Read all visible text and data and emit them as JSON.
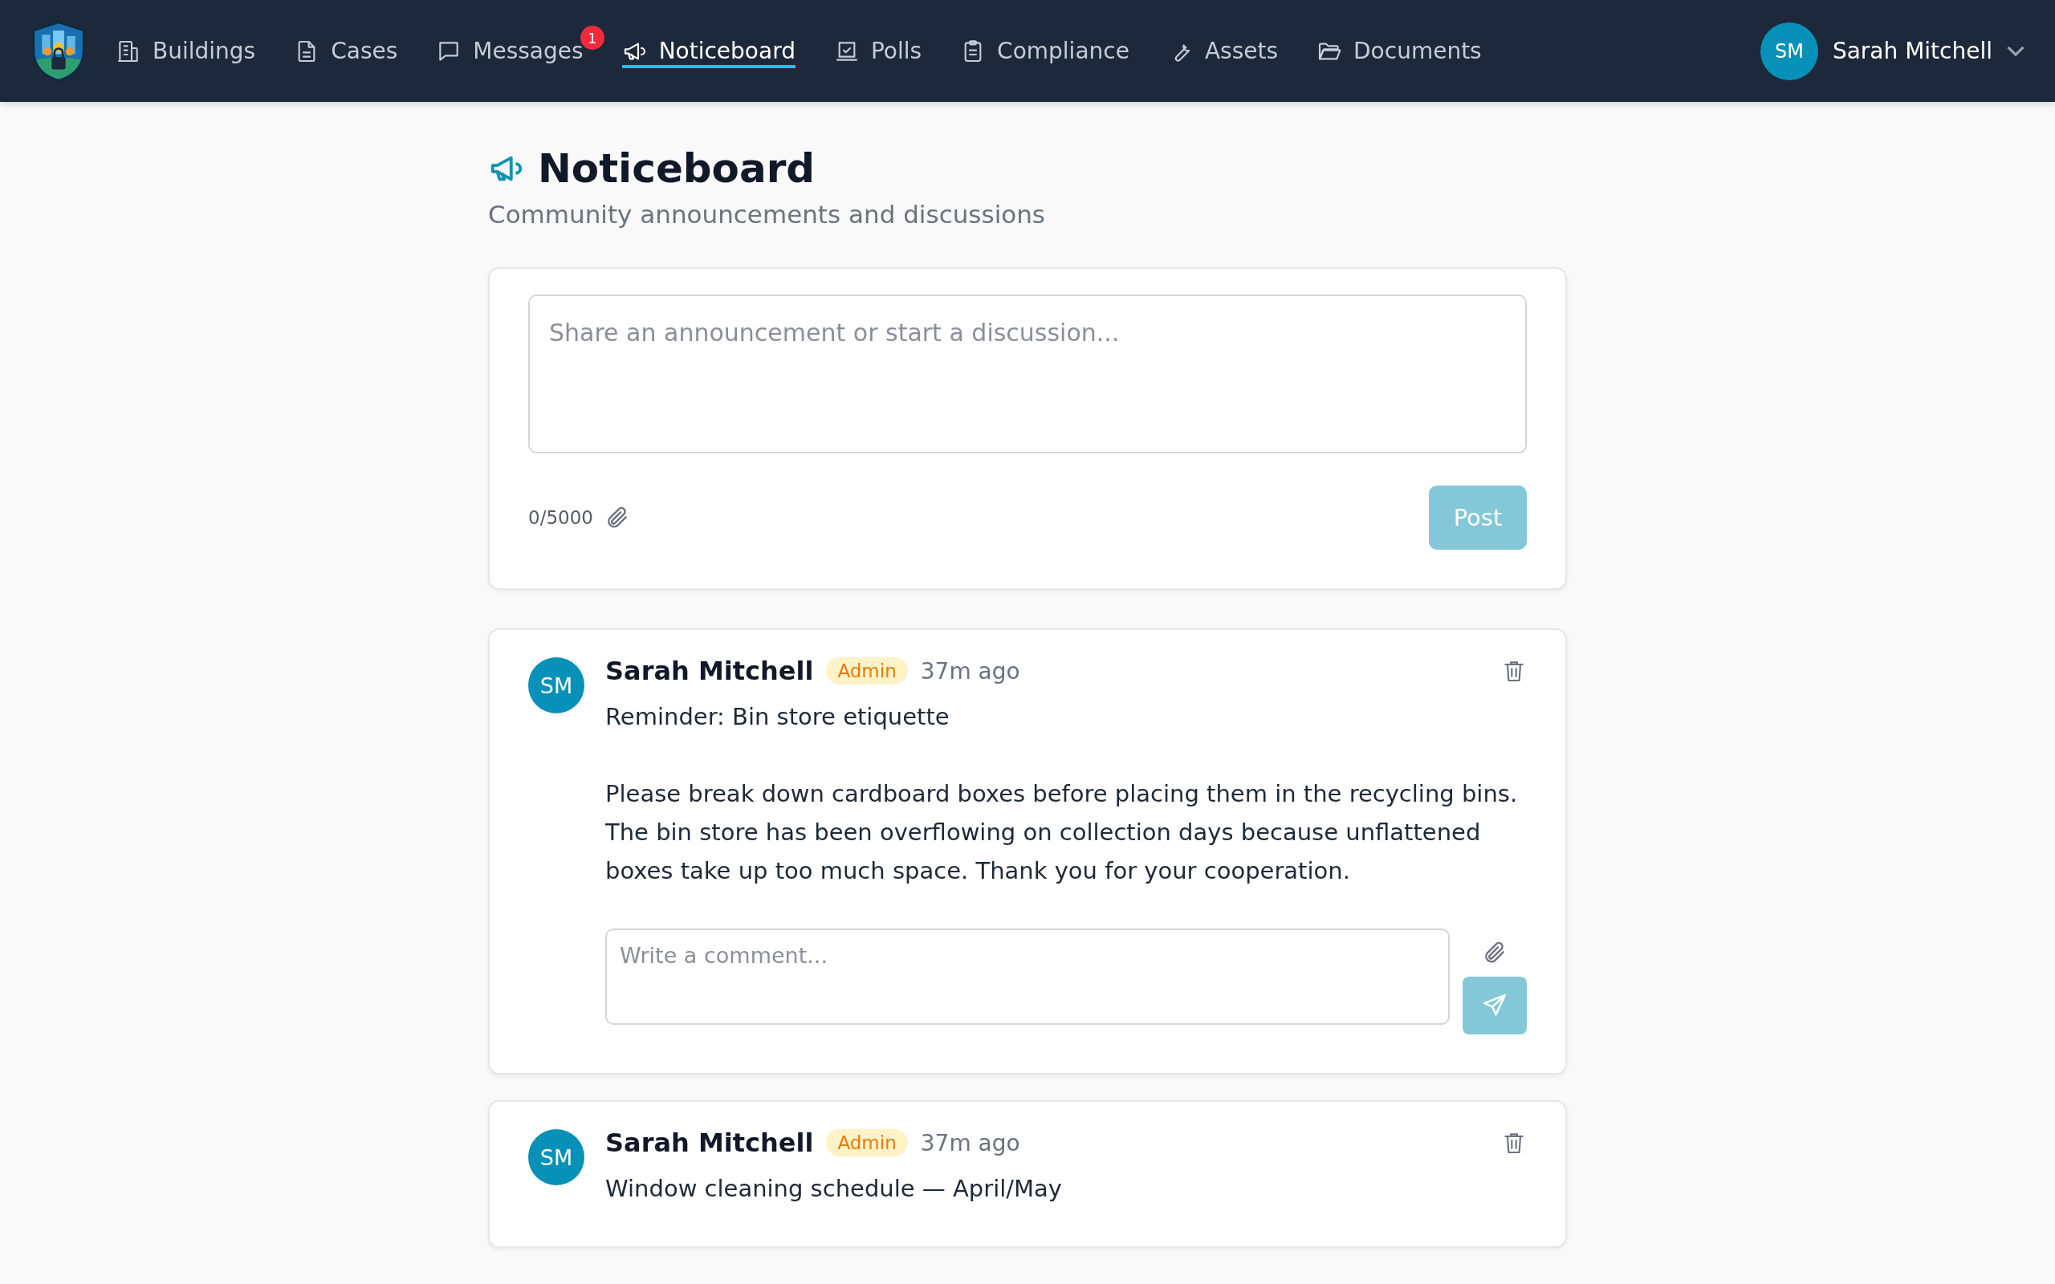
{
  "nav": {
    "items": [
      {
        "label": "Buildings",
        "selected": false
      },
      {
        "label": "Cases",
        "selected": false
      },
      {
        "label": "Messages",
        "selected": false,
        "badge": "1"
      },
      {
        "label": "Noticeboard",
        "selected": true
      },
      {
        "label": "Polls",
        "selected": false
      },
      {
        "label": "Compliance",
        "selected": false
      },
      {
        "label": "Assets",
        "selected": false
      },
      {
        "label": "Documents",
        "selected": false
      }
    ],
    "user": {
      "initials": "SM",
      "name": "Sarah Mitchell"
    }
  },
  "page": {
    "title": "Noticeboard",
    "subtitle": "Community announcements and discussions"
  },
  "composer": {
    "placeholder": "Share an announcement or start a discussion...",
    "count": "0/5000",
    "button": "Post"
  },
  "posts": [
    {
      "initials": "SM",
      "author": "Sarah Mitchell",
      "role": "Admin",
      "time": "37m ago",
      "paragraphs": [
        "Reminder: Bin store etiquette",
        "Please break down cardboard boxes before placing them in the recycling bins. The bin store has been overflowing on collection days because unflattened boxes take up too much space. Thank you for your cooperation."
      ],
      "comment_placeholder": "Write a comment..."
    },
    {
      "initials": "SM",
      "author": "Sarah Mitchell",
      "role": "Admin",
      "time": "37m ago",
      "paragraphs": [
        "Window cleaning schedule — April/May"
      ]
    }
  ]
}
